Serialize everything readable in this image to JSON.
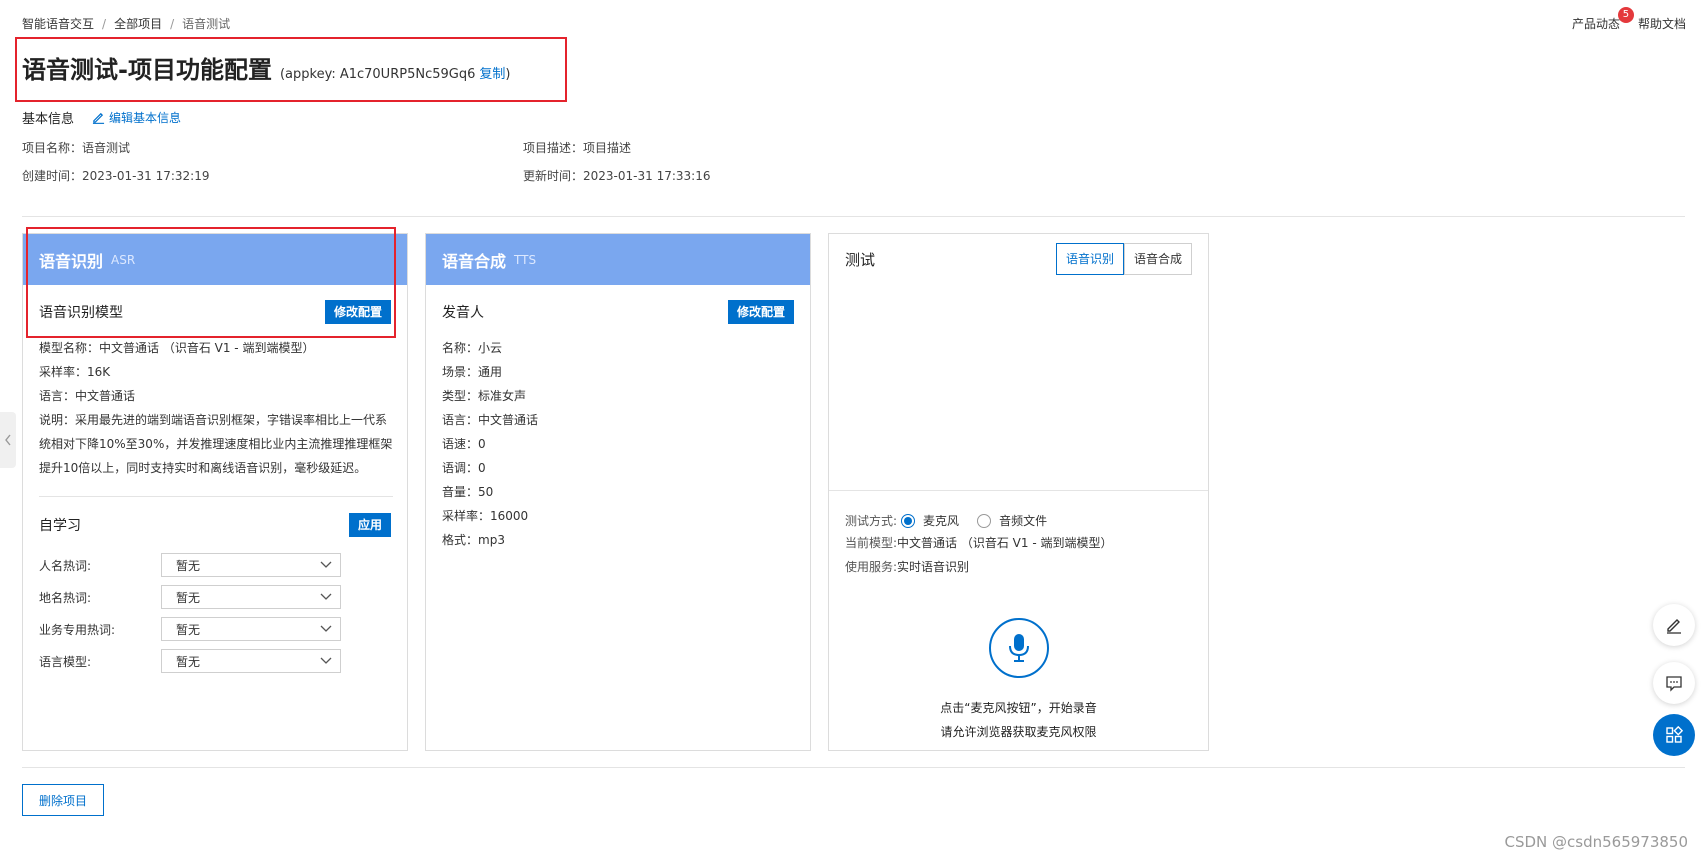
{
  "breadcrumb": {
    "items": [
      "智能语音交互",
      "全部项目",
      "语音测试"
    ],
    "separator": "/"
  },
  "topbar": {
    "news_label": "产品动态",
    "news_badge": "5",
    "help_label": "帮助文档"
  },
  "page": {
    "title": "语音测试-项目功能配置",
    "appkey_prefix": "(appkey: A1c70URP5Nc59Gq6",
    "copy_label": "复制",
    "appkey_suffix": ")"
  },
  "basic_info": {
    "title": "基本信息",
    "edit_label": "编辑基本信息",
    "name_label": "项目名称：",
    "name_value": "语音测试",
    "created_label": "创建时间：",
    "created_value": "2023-01-31 17:32:19",
    "desc_label": "项目描述：",
    "desc_value": "项目描述",
    "updated_label": "更新时间：",
    "updated_value": "2023-01-31 17:33:16"
  },
  "asr": {
    "title": "语音识别",
    "subtitle": "ASR",
    "model_section": "语音识别模型",
    "modify_label": "修改配置",
    "details": [
      {
        "label": "模型名称：",
        "value": "中文普通话 （识音石 V1 - 端到端模型）"
      },
      {
        "label": "采样率：",
        "value": "16K"
      },
      {
        "label": "语言：",
        "value": "中文普通话"
      }
    ],
    "description_lines": [
      "说明：采用最先进的端到端语音识别框架，字错误率相比上一代系",
      "统相对下降10%至30%，并发推理速度相比业内主流推理推理框架",
      "提升10倍以上，同时支持实时和离线语音识别，毫秒级延迟。"
    ],
    "self_learning": {
      "title": "自学习",
      "apply_label": "应用",
      "fields": [
        {
          "label": "人名热词:",
          "value": "暂无"
        },
        {
          "label": "地名热词:",
          "value": "暂无"
        },
        {
          "label": "业务专用热词:",
          "value": "暂无"
        },
        {
          "label": "语言模型:",
          "value": "暂无"
        }
      ]
    }
  },
  "tts": {
    "title": "语音合成",
    "subtitle": "TTS",
    "speaker_section": "发音人",
    "modify_label": "修改配置",
    "details": [
      {
        "label": "名称：",
        "value": "小云"
      },
      {
        "label": "场景：",
        "value": "通用"
      },
      {
        "label": "类型：",
        "value": "标准女声"
      },
      {
        "label": "语言：",
        "value": "中文普通话"
      },
      {
        "label": "语速：",
        "value": "0"
      },
      {
        "label": "语调：",
        "value": "0"
      },
      {
        "label": "音量：",
        "value": "50"
      },
      {
        "label": "采样率：",
        "value": "16000"
      },
      {
        "label": "格式：",
        "value": "mp3"
      }
    ]
  },
  "test": {
    "title": "测试",
    "tabs": [
      "语音识别",
      "语音合成"
    ],
    "active_tab": 0,
    "method_label": "测试方式:",
    "method_options": [
      "麦克风",
      "音频文件"
    ],
    "method_selected": 0,
    "model_label": "当前模型:",
    "model_value": "中文普通话 （识音石 V1 - 端到端模型）",
    "service_label": "使用服务:",
    "service_value": "实时语音识别",
    "tip_line1": "点击“麦克风按钮”，开始录音",
    "tip_line2": "请允许浏览器获取麦克风权限"
  },
  "footer": {
    "delete_label": "删除项目"
  },
  "watermark": "CSDN @csdn565973850",
  "colors": {
    "primary": "#0070cc",
    "panel_header": "#7aa7ef",
    "highlight_border": "#e4232c",
    "badge": "#e4393c"
  }
}
